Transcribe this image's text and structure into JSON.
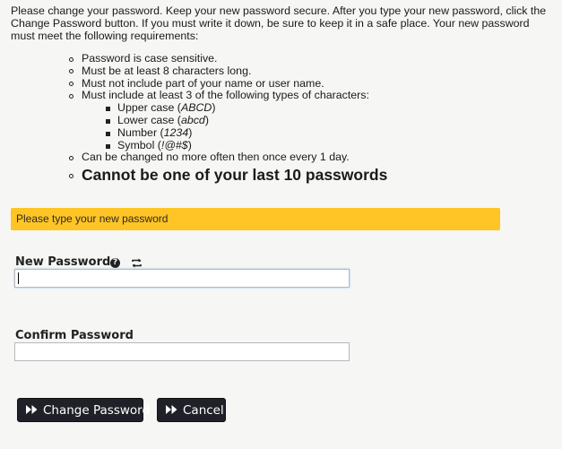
{
  "intro_text": "Please change your password. Keep your new password secure. After you type your new password, click the Change Password button. If you must write it down, be sure to keep it in a safe place. Your new password must meet the following requirements:",
  "requirements": {
    "case_sensitive": "Password is case sensitive.",
    "min_length": "Must be at least 8 characters long.",
    "no_name": "Must not include part of your name or user name.",
    "char_types_intro": "Must include at least 3 of the following types of characters:",
    "char_types": [
      {
        "label": "Upper case (",
        "example": "ABCD",
        "close": ")"
      },
      {
        "label": "Lower case (",
        "example": "abcd",
        "close": ")"
      },
      {
        "label": "Number (",
        "example": "1234",
        "close": ")"
      },
      {
        "label": "Symbol (",
        "example": "!@#$",
        "close": ")"
      }
    ],
    "change_frequency": "Can be changed no more often then once every 1 day.",
    "history": "Cannot be one of your last 10 passwords"
  },
  "notice": {
    "text": "Please type your new password",
    "color": "#ffc425"
  },
  "form": {
    "new_password_label": "New Password",
    "new_password_value": "",
    "confirm_password_label": "Confirm Password",
    "confirm_password_value": "",
    "help_icon": "question-circle-icon",
    "refresh_icon": "refresh-icon"
  },
  "buttons": {
    "change_password": "Change Password",
    "cancel": "Cancel",
    "icon": "fast-forward-icon"
  }
}
